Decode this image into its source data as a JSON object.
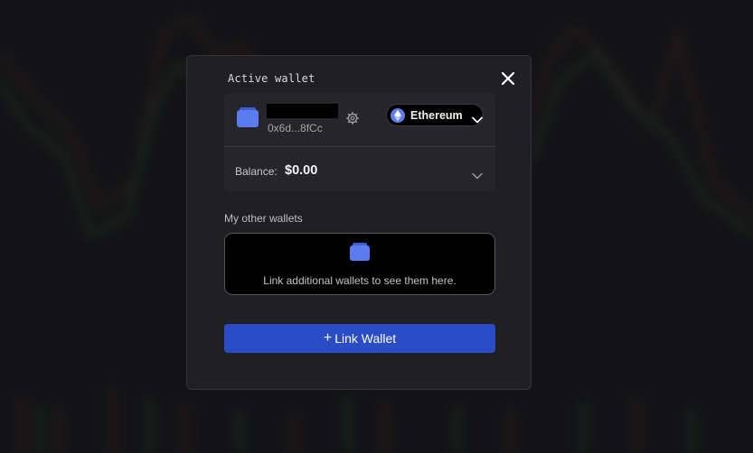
{
  "modal": {
    "title": "Active wallet"
  },
  "active_wallet": {
    "address": "0x6d...8fCc",
    "network": {
      "label": "Ethereum",
      "icon": "ethereum-icon"
    },
    "balance_label": "Balance:",
    "balance_value": "$0.00"
  },
  "other_wallets": {
    "heading": "My other wallets",
    "empty_text": "Link additional wallets to see them here."
  },
  "link_button": {
    "plus": "+",
    "label": "Link Wallet"
  },
  "colors": {
    "modal_bg": "#202024",
    "card_bg": "#26262a",
    "accent": "#2a4cc4",
    "wallet_icon": "#5b7cf0",
    "ethereum": "#627eea"
  },
  "icons": {
    "close": "close-icon",
    "wallet": "wallet-icon",
    "settings": "gear-icon",
    "chevron": "chevron-down-icon"
  }
}
